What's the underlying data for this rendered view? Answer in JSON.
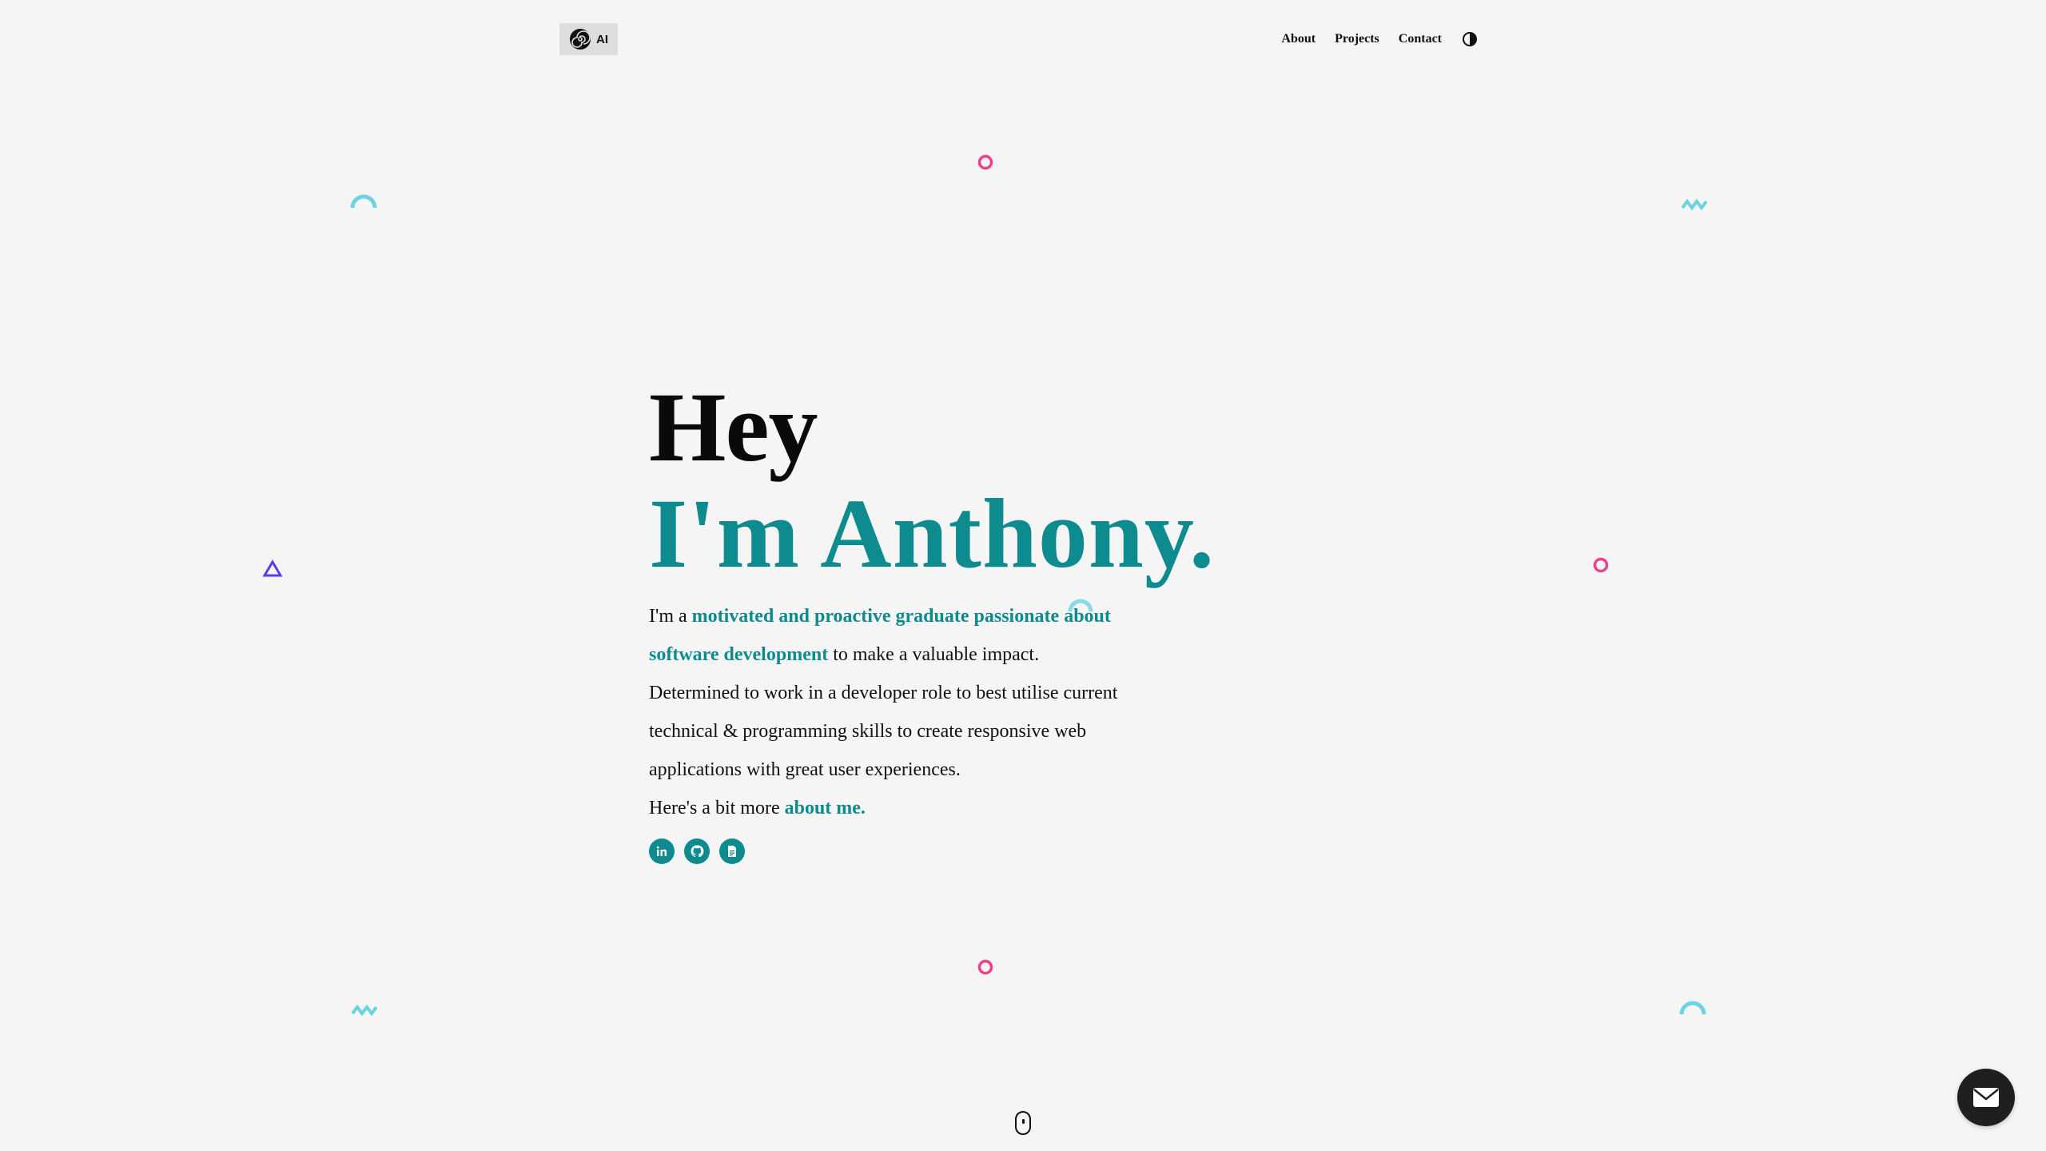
{
  "header": {
    "logo_text": "AI",
    "nav": [
      {
        "label": "About"
      },
      {
        "label": "Projects"
      },
      {
        "label": "Contact"
      }
    ],
    "theme_toggle_icon": "contrast-icon"
  },
  "hero": {
    "greeting": "Hey",
    "name": "I'm Anthony.",
    "bio": {
      "p1_prefix": "I'm a ",
      "p1_highlight": "motivated and proactive graduate passionate about software development",
      "p1_suffix": " to make a valuable impact.",
      "p2": "Determined to work in a developer role to best utilise current technical & programming skills to create responsive web applications with great user experiences.",
      "p3_prefix": "Here's a bit more ",
      "p3_link": "about me."
    },
    "socials": [
      {
        "icon": "linkedin-icon"
      },
      {
        "icon": "github-icon"
      },
      {
        "icon": "resume-icon"
      }
    ]
  },
  "floating_action": {
    "icon": "mail-icon"
  },
  "scroll_indicator": {
    "icon": "mouse-scroll-icon"
  },
  "colors": {
    "accent": "#0d8b8f",
    "background": "#f5f5f5",
    "pink": "#ec3f8c",
    "cyan": "#6ed3e0",
    "purple": "#5b3cf0"
  }
}
